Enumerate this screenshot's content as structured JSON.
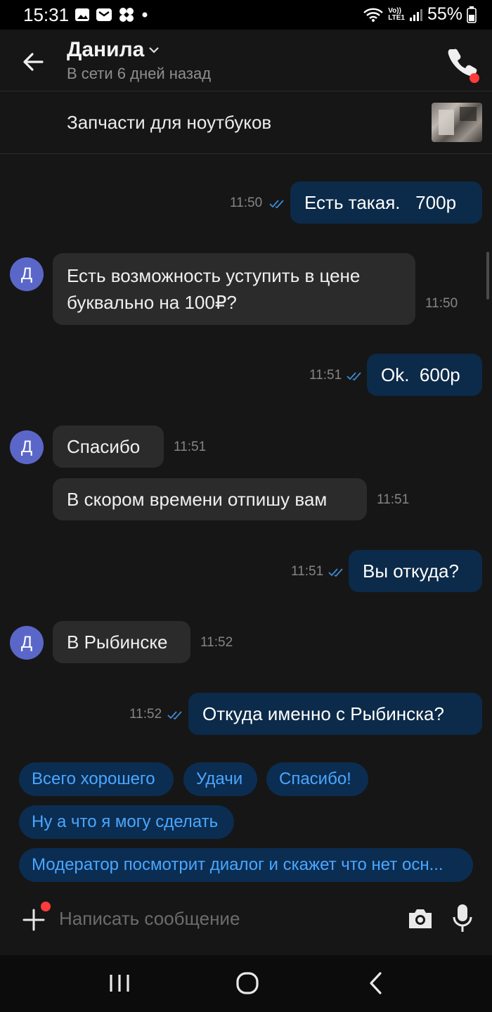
{
  "status_bar": {
    "time": "15:31",
    "lte_label_top": "Vo))",
    "lte_label_bottom": "LTE1",
    "battery": "55%"
  },
  "header": {
    "name": "Данила",
    "status": "В сети 6 дней назад"
  },
  "product": {
    "title": "Запчасти для ноутбуков"
  },
  "avatar_letter": "Д",
  "messages": [
    {
      "dir": "out",
      "text": "Есть такая.   700р",
      "time": "11:50"
    },
    {
      "dir": "in",
      "text": "Есть возможность уступить в цене буквально на 100₽?",
      "time": "11:50"
    },
    {
      "dir": "out",
      "text": "Ok.  600р",
      "time": "11:51"
    },
    {
      "dir": "in",
      "text": "Спасибо",
      "time": "11:51"
    },
    {
      "dir": "in",
      "text": "В скором времени отпишу вам",
      "time": "11:51"
    },
    {
      "dir": "out",
      "text": "Вы откуда?",
      "time": "11:51"
    },
    {
      "dir": "in",
      "text": "В Рыбинске",
      "time": "11:52"
    },
    {
      "dir": "out",
      "text": "Откуда именно с Рыбинска?",
      "time": "11:52"
    }
  ],
  "quick_replies": [
    "Всего хорошего",
    "Удачи",
    "Спасибо!",
    "Ну а что я могу сделать",
    "Модератор посмотрит диалог и скажет что нет осн..."
  ],
  "composer": {
    "placeholder": "Написать сообщение"
  },
  "colors": {
    "outgoing_bubble": "#0c2a49",
    "incoming_bubble": "#2b2b2b",
    "avatar": "#5b67c8",
    "chip_bg": "#0b2d52",
    "chip_text": "#4aa7ff",
    "accent_red": "#ff3b3b"
  }
}
